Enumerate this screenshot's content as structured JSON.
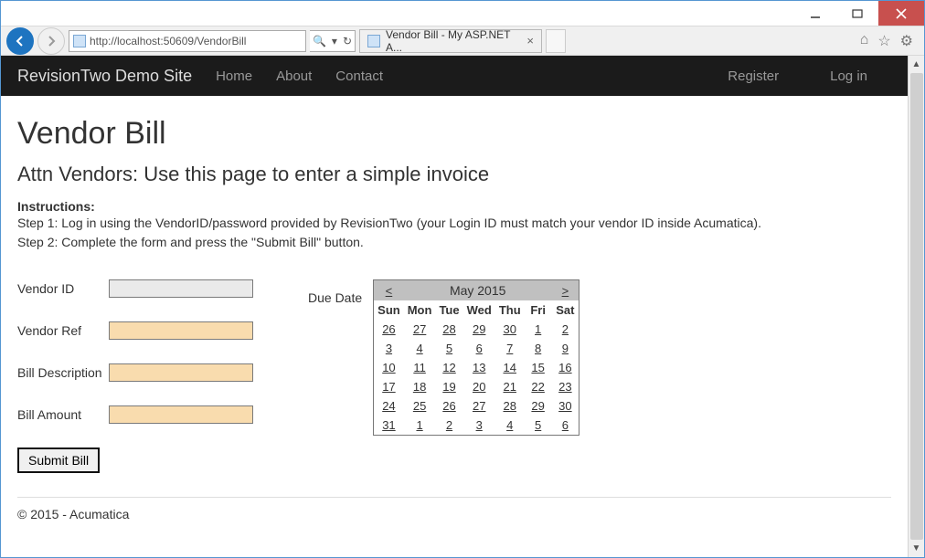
{
  "browser": {
    "url": "http://localhost:50609/VendorBill",
    "tab_title": "Vendor Bill - My ASP.NET A..."
  },
  "site_nav": {
    "brand": "RevisionTwo Demo Site",
    "links": [
      "Home",
      "About",
      "Contact"
    ],
    "right_links": [
      "Register",
      "Log in"
    ]
  },
  "page": {
    "title": "Vendor Bill",
    "subtitle": "Attn Vendors: Use this page to enter a simple invoice",
    "instr_title": "Instructions:",
    "instr_lines": [
      "Step 1: Log in using the VendorID/password provided by RevisionTwo (your Login ID must match your vendor ID inside Acumatica).",
      "Step 2: Complete the form and press the \"Submit Bill\" button."
    ],
    "form": {
      "vendor_id_label": "Vendor ID",
      "vendor_ref_label": "Vendor Ref",
      "bill_desc_label": "Bill Description",
      "bill_amount_label": "Bill Amount",
      "due_date_label": "Due Date",
      "submit_label": "Submit Bill",
      "values": {
        "vendor_id": "",
        "vendor_ref": "",
        "bill_desc": "",
        "bill_amount": ""
      }
    },
    "calendar": {
      "prev": "<",
      "next": ">",
      "title": "May 2015",
      "dow": [
        "Sun",
        "Mon",
        "Tue",
        "Wed",
        "Thu",
        "Fri",
        "Sat"
      ],
      "weeks": [
        [
          26,
          27,
          28,
          29,
          30,
          1,
          2
        ],
        [
          3,
          4,
          5,
          6,
          7,
          8,
          9
        ],
        [
          10,
          11,
          12,
          13,
          14,
          15,
          16
        ],
        [
          17,
          18,
          19,
          20,
          21,
          22,
          23
        ],
        [
          24,
          25,
          26,
          27,
          28,
          29,
          30
        ],
        [
          31,
          1,
          2,
          3,
          4,
          5,
          6
        ]
      ]
    },
    "footer": "© 2015 - Acumatica"
  }
}
